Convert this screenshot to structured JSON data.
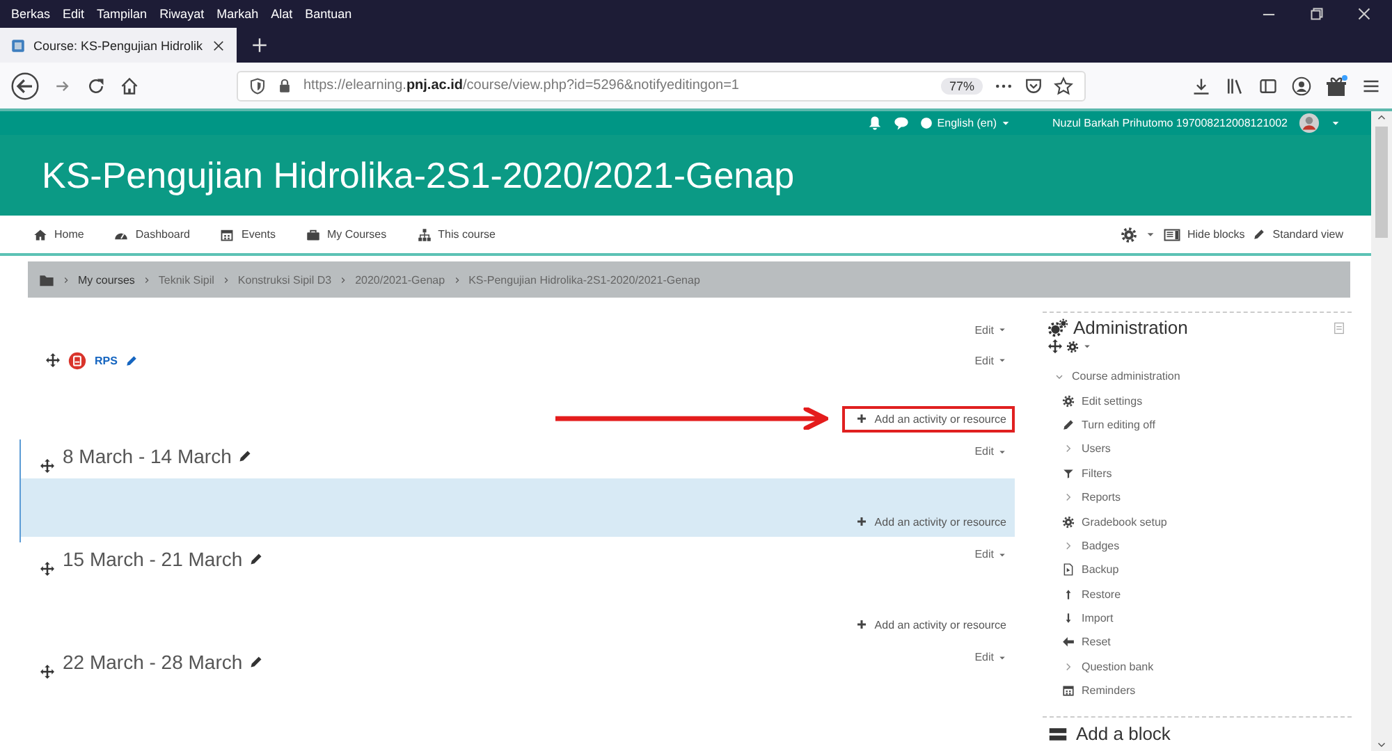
{
  "browser": {
    "menu": [
      "Berkas",
      "Edit",
      "Tampilan",
      "Riwayat",
      "Markah",
      "Alat",
      "Bantuan"
    ],
    "tab": {
      "title": "Course: KS-Pengujian Hidrolik"
    },
    "url": {
      "prefix": "https://elearning.",
      "domain": "pnj.ac.id",
      "path": "/course/view.php?id=5296&notifyeditingon=1"
    },
    "zoom": "77%"
  },
  "topbar": {
    "language": "English (en)",
    "user": "Nuzul Barkah Prihutomo 197008212008121002"
  },
  "header": {
    "title": "KS-Pengujian Hidrolika-2S1-2020/2021-Genap"
  },
  "nav": {
    "items": [
      {
        "label": "Home",
        "kind": "home"
      },
      {
        "label": "Dashboard",
        "kind": "dashboard"
      },
      {
        "label": "Events",
        "kind": "calendar"
      },
      {
        "label": "My Courses",
        "kind": "briefcase"
      },
      {
        "label": "This course",
        "kind": "sitemap"
      }
    ],
    "hide_blocks": "Hide blocks",
    "standard_view": "Standard view"
  },
  "breadcrumb": [
    "My courses",
    "Teknik Sipil",
    "Konstruksi Sipil D3",
    "2020/2021-Genap",
    "KS-Pengujian Hidrolika-2S1-2020/2021-Genap"
  ],
  "sections": [
    {
      "edit": "Edit",
      "activities": [
        {
          "name": "RPS",
          "edit": "Edit"
        }
      ],
      "add": "Add an activity or resource",
      "callout": true,
      "current": false
    },
    {
      "title": "8 March - 14 March",
      "edit": "Edit",
      "add": "Add an activity or resource",
      "callout": false,
      "current": true
    },
    {
      "title": "15 March - 21 March",
      "edit": "Edit",
      "add": "Add an activity or resource",
      "callout": false,
      "current": false
    },
    {
      "title": "22 March - 28 March",
      "edit": "Edit",
      "callout": false,
      "current": false
    }
  ],
  "admin": {
    "title": "Administration",
    "tree": [
      {
        "label": "Course administration",
        "expanded": true,
        "children": [
          {
            "label": "Edit settings",
            "kind": "settings"
          },
          {
            "label": "Turn editing off",
            "kind": "edit"
          },
          {
            "label": "Users",
            "kind": "branch"
          },
          {
            "label": "Filters",
            "kind": "filter"
          },
          {
            "label": "Reports",
            "kind": "branch"
          },
          {
            "label": "Gradebook setup",
            "kind": "settings"
          },
          {
            "label": "Badges",
            "kind": "branch"
          },
          {
            "label": "Backup",
            "kind": "backup"
          },
          {
            "label": "Restore",
            "kind": "restore"
          },
          {
            "label": "Import",
            "kind": "import"
          },
          {
            "label": "Reset",
            "kind": "reset"
          },
          {
            "label": "Question bank",
            "kind": "branch"
          },
          {
            "label": "Reminders",
            "kind": "calendar"
          }
        ]
      }
    ]
  },
  "add_block": {
    "title": "Add a block"
  }
}
